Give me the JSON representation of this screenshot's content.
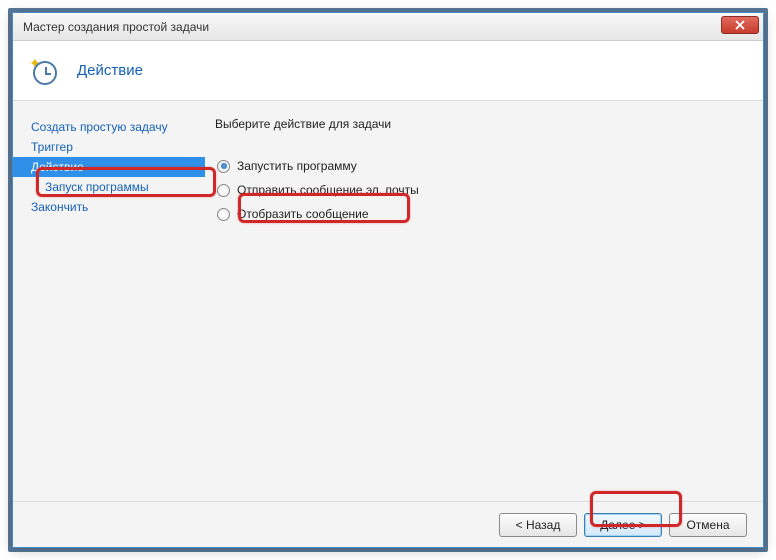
{
  "window": {
    "title": "Мастер создания простой задачи"
  },
  "header": {
    "title": "Действие"
  },
  "sidebar": {
    "items": [
      {
        "label": "Создать простую задачу"
      },
      {
        "label": "Триггер"
      },
      {
        "label": "Действие"
      },
      {
        "label": "Запуск программы"
      },
      {
        "label": "Закончить"
      }
    ]
  },
  "content": {
    "heading": "Выберите действие для задачи",
    "options": [
      {
        "label": "Запустить программу"
      },
      {
        "label": "Отправить сообщение эл. почты"
      },
      {
        "label": "Отобразить сообщение"
      }
    ]
  },
  "buttons": {
    "back": "< Назад",
    "next": "Далее >",
    "cancel": "Отмена"
  }
}
